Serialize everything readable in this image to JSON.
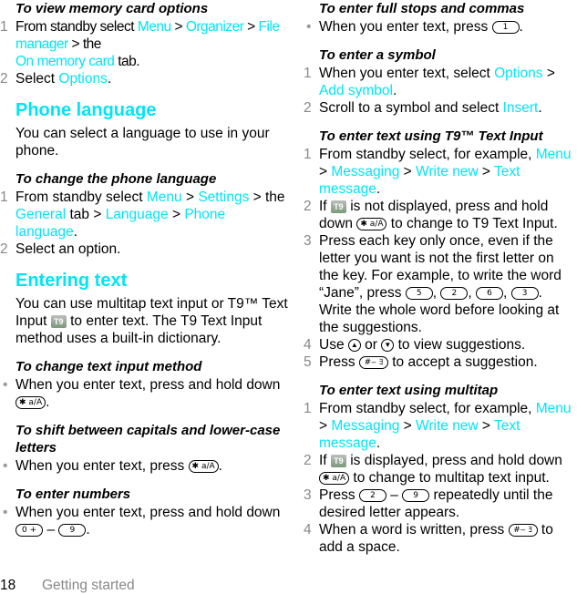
{
  "left": {
    "s1": {
      "title": "To view memory card options",
      "step1": {
        "num": "1",
        "t1": "From standby select ",
        "l1": "Menu",
        "t2": " > ",
        "l2": "Organizer",
        "t3": " > ",
        "l3": "File manager",
        "t4": " > the ",
        "l4": "On memory card",
        "t5": " tab."
      },
      "step2": {
        "num": "2",
        "t1": "Select ",
        "l1": "Options",
        "t2": "."
      }
    },
    "h_lang": "Phone language",
    "p_lang": "You can select a language to use in your phone.",
    "s2": {
      "title": "To change the phone language",
      "step1": {
        "num": "1",
        "t1": "From standby select ",
        "l1": "Menu",
        "t2": " > ",
        "l2": "Settings",
        "t3": " > the ",
        "l3": "General",
        "t4": " tab > ",
        "l4": "Language",
        "t5": " > ",
        "l5": "Phone language",
        "t6": "."
      },
      "step2": {
        "num": "2",
        "t1": "Select an option."
      }
    },
    "h_text": "Entering text",
    "p_text1": "You can use multitap text input or T9™ Text Input ",
    "p_text2": " to enter text. The T9 Text Input method uses a built-in dictionary.",
    "s3": {
      "title": "To change text input method",
      "b1": "When you enter text, press and hold down ",
      "b2": "."
    },
    "s4": {
      "title": "To shift between capitals and lower-case letters",
      "b1": "When you enter text, press ",
      "b2": "."
    },
    "s5": {
      "title": "To enter numbers",
      "b1": "When you enter text, press and hold down ",
      "dash": " – ",
      "b2": "."
    }
  },
  "right": {
    "s1": {
      "title": "To enter full stops and commas",
      "b1": "When you enter text, press ",
      "b2": "."
    },
    "s2": {
      "title": "To enter a symbol",
      "step1": {
        "num": "1",
        "t1": "When you enter text, select ",
        "l1": "Options",
        "t2": " > ",
        "l2": "Add symbol",
        "t3": "."
      },
      "step2": {
        "num": "2",
        "t1": "Scroll to a symbol and select ",
        "l1": "Insert",
        "t2": "."
      }
    },
    "s3": {
      "title": "To enter text using T9™ Text Input",
      "step1": {
        "num": "1",
        "t1": "From standby select, for example, ",
        "l1": "Menu",
        "t2": " > ",
        "l2": "Messaging",
        "t3": " > ",
        "l3": "Write new",
        "t4": " > ",
        "l4": "Text message",
        "t5": "."
      },
      "step2": {
        "num": "2",
        "t1": "If ",
        "t2": " is not displayed, press and hold down ",
        "t3": " to change to T9 Text Input."
      },
      "step3": {
        "num": "3",
        "t1": "Press each key only once, even if the letter you want is not the first letter on the key. For example, to write the word “Jane”, press ",
        "c": ", ",
        "t2": ". Write the whole word before looking at the suggestions."
      },
      "step4": {
        "num": "4",
        "t1": "Use ",
        "t2": " or ",
        "t3": " to view suggestions."
      },
      "step5": {
        "num": "5",
        "t1": "Press ",
        "t2": " to accept a suggestion."
      }
    },
    "s4": {
      "title": "To enter text using multitap",
      "step1": {
        "num": "1",
        "t1": "From standby select, for example, ",
        "l1": "Menu",
        "t2": " > ",
        "l2": "Messaging",
        "t3": " > ",
        "l3": "Write new",
        "t4": " > ",
        "l4": "Text message",
        "t5": "."
      },
      "step2": {
        "num": "2",
        "t1": "If ",
        "t2": " is displayed, press and hold down ",
        "t3": " to change to multitap text input."
      },
      "step3": {
        "num": "3",
        "t1": "Press ",
        "dash": " – ",
        "t2": " repeatedly until the desired letter appears."
      },
      "step4": {
        "num": "4",
        "t1": "When a word is written, press ",
        "t2": " to add a space."
      }
    }
  },
  "keys": {
    "star": "✱ a/A",
    "hash": "#‒ ﾖ",
    "k0": "0 +",
    "k1": "1",
    "k2": "2",
    "k3": "3",
    "k5": "5",
    "k6": "6",
    "k9": "9",
    "t9": "T9",
    "up": "▲",
    "down": "▼"
  },
  "bullet": "•",
  "footer": {
    "page": "18",
    "section": "Getting started"
  }
}
